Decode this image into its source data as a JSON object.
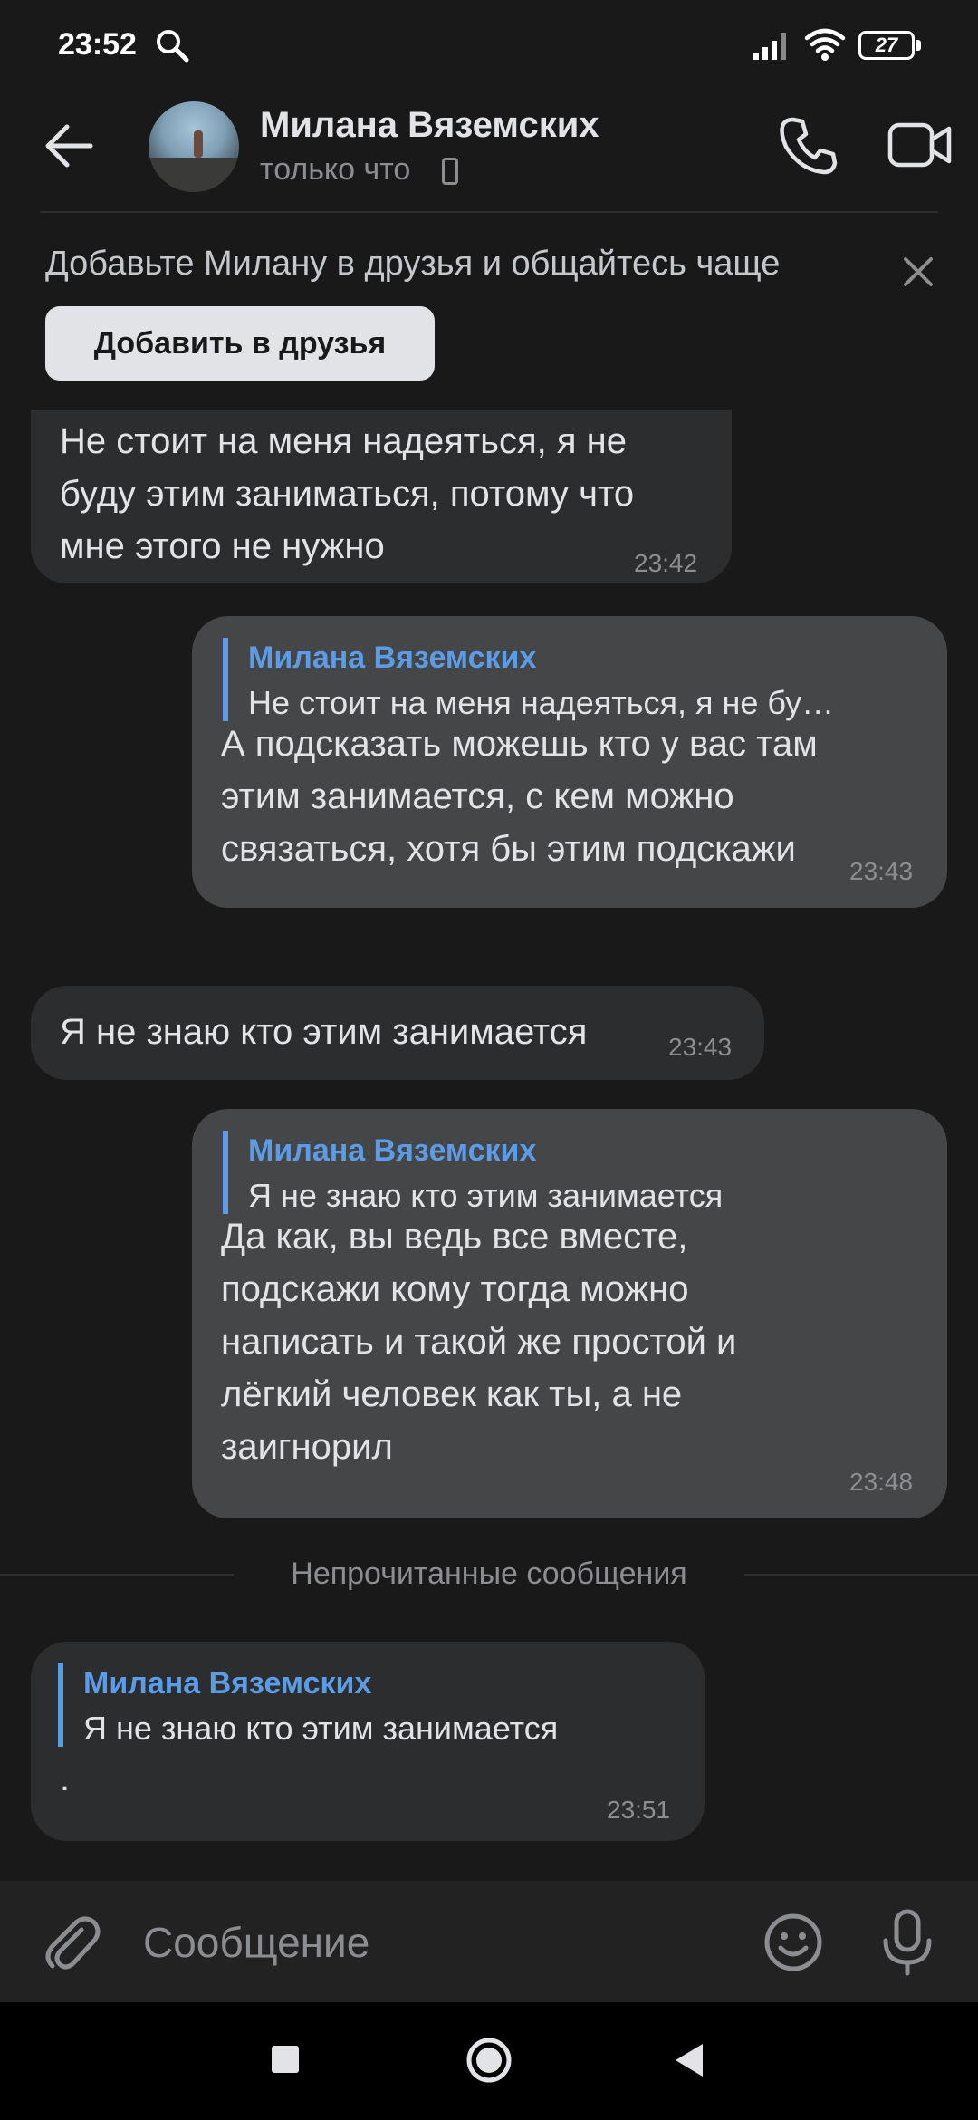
{
  "status_bar": {
    "time": "23:52",
    "battery": "27"
  },
  "header": {
    "contact_name": "Милана Вяземских",
    "status": "только что"
  },
  "friend_banner": {
    "text": "Добавьте Милану в друзья и общайтесь чаще",
    "button_label": "Добавить в друзья"
  },
  "messages": [
    {
      "direction": "in",
      "lines": [
        "Не стоит на меня надеяться, я не",
        "буду этим заниматься, потому что",
        "мне этого не нужно"
      ],
      "time": "23:42"
    },
    {
      "direction": "out",
      "reply_author": "Милана Вяземских",
      "reply_text": "Не стоит на меня надеяться, я не бу…",
      "lines": [
        "А подсказать можешь кто у вас там",
        "этим занимается, с кем можно",
        "связаться, хотя бы этим подскажи"
      ],
      "time": "23:43"
    },
    {
      "direction": "in",
      "lines": [
        "Я не знаю кто этим занимается"
      ],
      "time": "23:43"
    },
    {
      "direction": "out",
      "reply_author": "Милана Вяземских",
      "reply_text": "Я не знаю кто этим занимается",
      "lines": [
        "Да как, вы ведь все вместе,",
        "подскажи кому тогда можно",
        "написать и такой же простой и",
        "лёгкий человек как ты, а не",
        "заигнорил"
      ],
      "time": "23:48"
    },
    {
      "direction": "in",
      "reply_author": "Милана Вяземских",
      "reply_text": "Я не знаю кто этим занимается",
      "lines": [
        "."
      ],
      "time": "23:51"
    }
  ],
  "unread_divider": "Непрочитанные сообщения",
  "composer": {
    "placeholder": "Сообщение"
  },
  "icons": {
    "search": "search-icon",
    "signal": "signal-icon",
    "wifi": "wifi-icon",
    "battery": "battery-icon",
    "back": "back-arrow-icon",
    "call": "phone-icon",
    "video": "video-camera-icon",
    "close": "close-icon",
    "attach": "paperclip-icon",
    "emoji": "emoji-icon",
    "mic": "microphone-icon"
  },
  "colors": {
    "background": "#19191a",
    "incoming_bubble": "#2c2d2e",
    "outgoing_bubble": "#454647",
    "accent": "#5c9ce6"
  }
}
